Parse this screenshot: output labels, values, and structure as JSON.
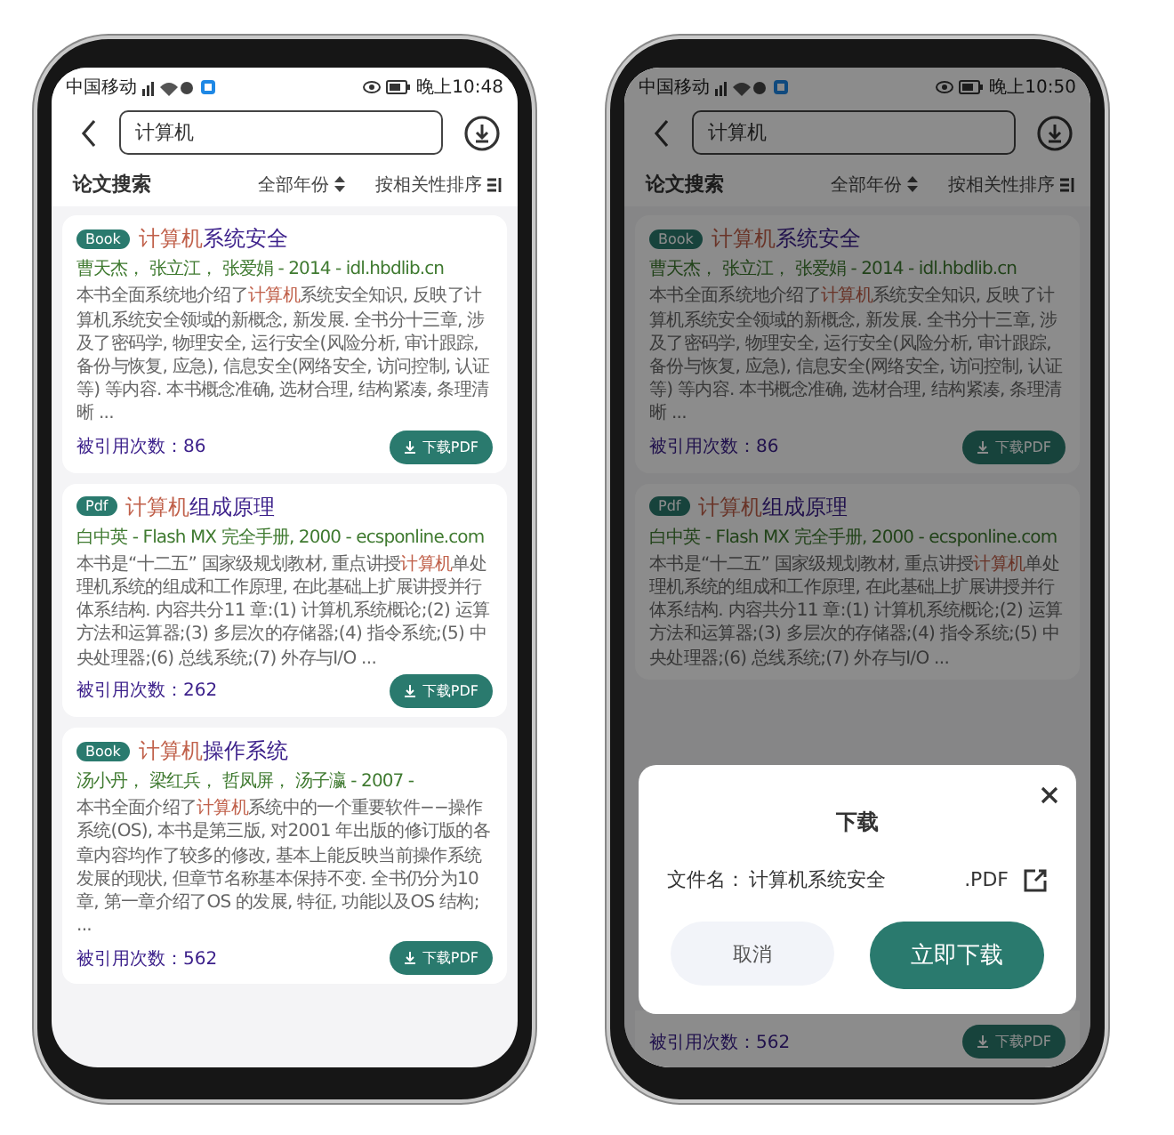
{
  "phones": [
    {
      "status_bar": {
        "carrier": "中国移动",
        "time": "晚上10:48"
      },
      "search": {
        "value": "计算机"
      },
      "section_title": "论文搜索",
      "year_filter": "全部年份",
      "sort": "按相关性排序",
      "results": [
        {
          "badge": "Book",
          "title": [
            {
              "text": "计算机",
              "highlight": true
            },
            {
              "text": "系统安全",
              "highlight": false
            }
          ],
          "meta": "曹天杰， 张立江， 张爱娟 - 2014 - idl.hbdlib.cn",
          "abstract": [
            {
              "text": "本书全面系统地介绍了",
              "highlight": false
            },
            {
              "text": "计算机",
              "highlight": true
            },
            {
              "text": "系统安全知识, 反映了计算机系统安全领域的新概念, 新发展. 全书分十三章, 涉及了密码学, 物理安全, 运行安全(风险分析, 审计跟踪, 备份与恢复, 应急), 信息安全(网络安全, 访问控制, 认证等) 等内容. 本书概念准确, 选材合理, 结构紧凑, 条理清晰 ...",
              "highlight": false
            }
          ],
          "citations": "被引用次数：86",
          "download": "下载PDF"
        },
        {
          "badge": "Pdf",
          "title": [
            {
              "text": "计算机",
              "highlight": true
            },
            {
              "text": "组成原理",
              "highlight": false
            }
          ],
          "meta": "白中英 - Flash MX 完全手册, 2000 - ecsponline.com",
          "abstract": [
            {
              "text": "本书是“十二五” 国家级规划教材, 重点讲授",
              "highlight": false
            },
            {
              "text": "计算机",
              "highlight": true
            },
            {
              "text": "单处理机系统的组成和工作原理, 在此基础上扩展讲授并行体系结构. 内容共分11 章:(1) 计算机系统概论;(2) 运算方法和运算器;(3) 多层次的存储器;(4) 指令系统;(5) 中央处理器;(6) 总线系统;(7) 外存与I/O ...",
              "highlight": false
            }
          ],
          "citations": "被引用次数：262",
          "download": "下载PDF"
        },
        {
          "badge": "Book",
          "title": [
            {
              "text": "计算机",
              "highlight": true
            },
            {
              "text": "操作系统",
              "highlight": false
            }
          ],
          "meta": "汤小丹， 梁红兵， 哲凤屏， 汤子瀛 - 2007 -",
          "abstract": [
            {
              "text": "本书全面介绍了",
              "highlight": false
            },
            {
              "text": "计算机",
              "highlight": true
            },
            {
              "text": "系统中的一个重要软件−−操作系统(OS), 本书是第三版, 对2001 年出版的修订版的各章内容均作了较多的修改, 基本上能反映当前操作系统发展的现状, 但章节名称基本保持不变. 全书仍分为10 章, 第一章介绍了OS 的发展, 特征, 功能以及OS 结构; ...",
              "highlight": false
            }
          ],
          "citations": "被引用次数：562",
          "download": "下载PDF"
        }
      ]
    },
    {
      "status_bar": {
        "carrier": "中国移动",
        "time": "晚上10:50"
      },
      "search": {
        "value": "计算机"
      },
      "section_title": "论文搜索",
      "year_filter": "全部年份",
      "sort": "按相关性排序",
      "results": [
        {
          "badge": "Book",
          "title": [
            {
              "text": "计算机",
              "highlight": true
            },
            {
              "text": "系统安全",
              "highlight": false
            }
          ],
          "meta": "曹天杰， 张立江， 张爱娟 - 2014 - idl.hbdlib.cn",
          "abstract": [
            {
              "text": "本书全面系统地介绍了",
              "highlight": false
            },
            {
              "text": "计算机",
              "highlight": true
            },
            {
              "text": "系统安全知识, 反映了计算机系统安全领域的新概念, 新发展. 全书分十三章, 涉及了密码学, 物理安全, 运行安全(风险分析, 审计跟踪, 备份与恢复, 应急), 信息安全(网络安全, 访问控制, 认证等) 等内容. 本书概念准确, 选材合理, 结构紧凑, 条理清晰 ...",
              "highlight": false
            }
          ],
          "citations": "被引用次数：86",
          "download": "下载PDF"
        },
        {
          "badge": "Pdf",
          "title": [
            {
              "text": "计算机",
              "highlight": true
            },
            {
              "text": "组成原理",
              "highlight": false
            }
          ],
          "meta": "白中英 - Flash MX 完全手册, 2000 - ecsponline.com",
          "abstract": [
            {
              "text": "本书是“十二五” 国家级规划教材, 重点讲授",
              "highlight": false
            },
            {
              "text": "计算机",
              "highlight": true
            },
            {
              "text": "单处理机系统的组成和工作原理, 在此基础上扩展讲授并行体系结构. 内容共分11 章:(1) 计算机系统概论;(2) 运算方法和运算器;(3) 多层次的存储器;(4) 指令系统;(5) 中央处理器;(6) 总线系统;(7) 外存与I/O ...",
              "highlight": false
            }
          ]
        },
        {
          "citations": "被引用次数：562",
          "download": "下载PDF"
        }
      ],
      "dialog": {
        "title": "下载",
        "filename_label": "文件名：",
        "filename": "计算机系统安全",
        "extension": ".PDF",
        "cancel": "取消",
        "confirm": "立即下载"
      }
    }
  ]
}
